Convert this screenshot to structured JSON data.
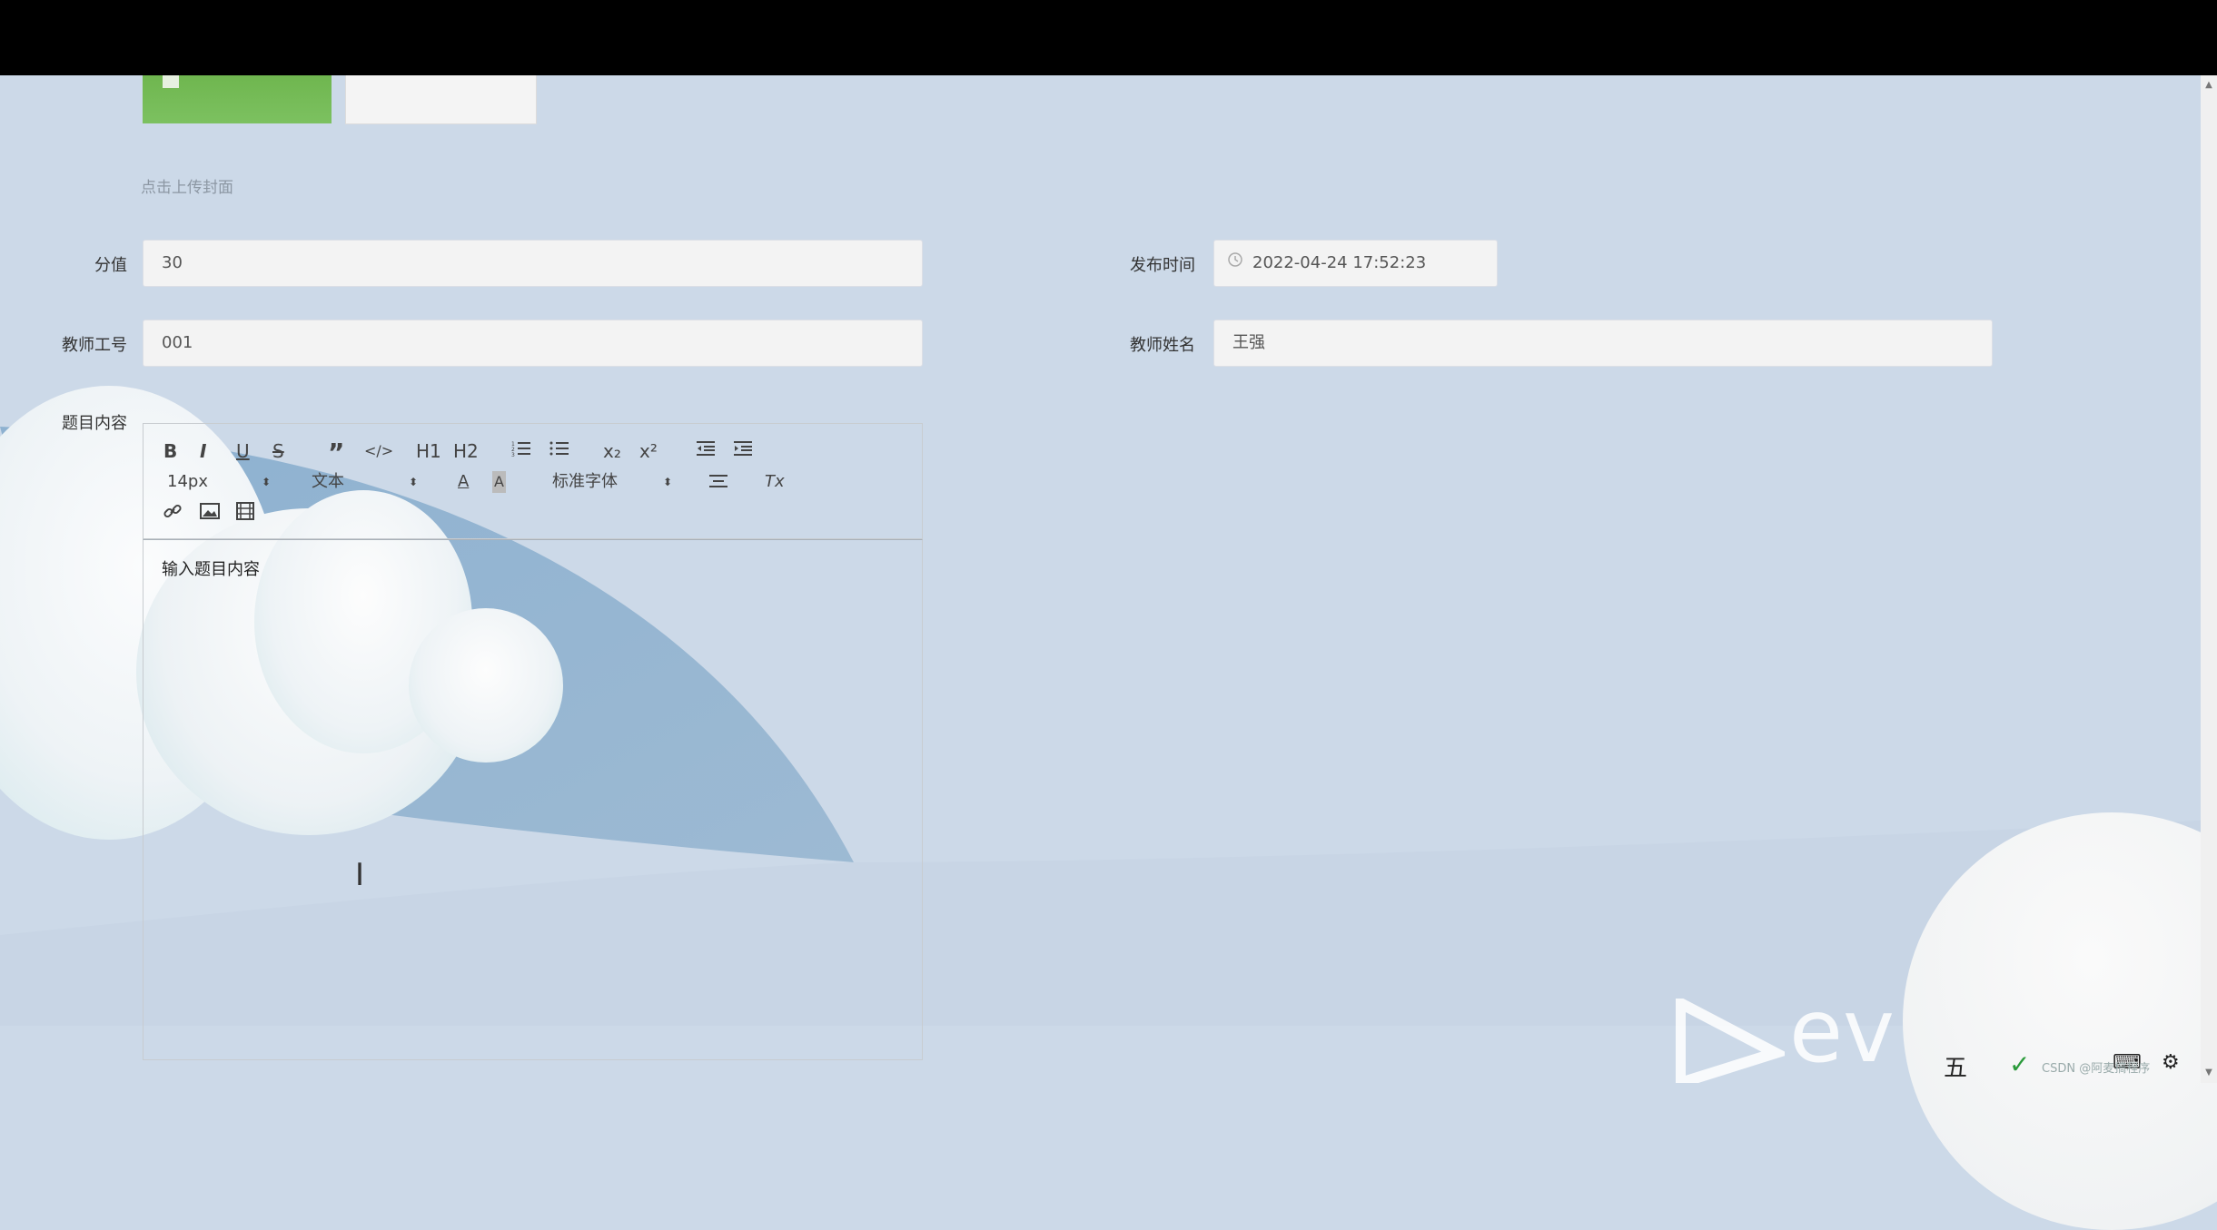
{
  "form": {
    "upload_hint": "点击上传封面",
    "score": {
      "label": "分值",
      "value": "30"
    },
    "publish_time": {
      "label": "发布时间",
      "value": "2022-04-24 17:52:23"
    },
    "teacher_id": {
      "label": "教师工号",
      "value": "001"
    },
    "teacher_name": {
      "label": "教师姓名",
      "value": "王强"
    },
    "content": {
      "label": "题目内容",
      "placeholder": "输入题目内容"
    }
  },
  "editor_toolbar": {
    "bold": "B",
    "italic": "I",
    "underline": "U",
    "strike": "S",
    "blockquote": "”",
    "code": "</>",
    "h1": "H1",
    "h2": "H2",
    "subscript": "x₂",
    "superscript": "x²",
    "font_size": "14px",
    "header_select": "文本",
    "font_family": "标准字体",
    "clear_format": "Tx"
  },
  "overlay": {
    "watermark": "ev",
    "csdn": "CSDN @阿麦搞程序",
    "ime": "五"
  },
  "colors": {
    "background": "#ccd9e8",
    "field_bg": "#f3f3f3",
    "green_thumb": "#72b854"
  }
}
